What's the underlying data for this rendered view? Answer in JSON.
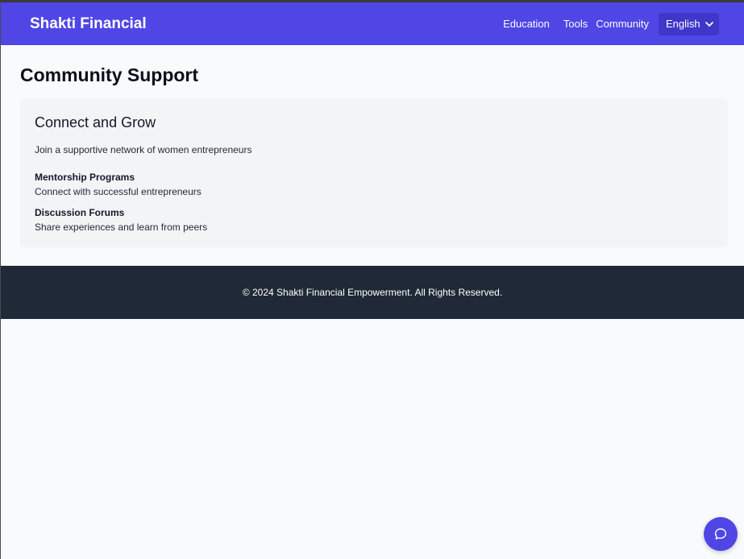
{
  "header": {
    "brand": "Shakti Financial",
    "nav": [
      {
        "label": "Education"
      },
      {
        "label": "Tools"
      },
      {
        "label": "Community"
      }
    ],
    "language": {
      "selected": "English",
      "icon": "chevron-down-icon"
    }
  },
  "main": {
    "title": "Community Support",
    "card": {
      "title": "Connect and Grow",
      "description": "Join a supportive network of women entrepreneurs",
      "features": [
        {
          "title": "Mentorship Programs",
          "description": "Connect with successful entrepreneurs"
        },
        {
          "title": "Discussion Forums",
          "description": "Share experiences and learn from peers"
        }
      ]
    }
  },
  "footer": {
    "text": "© 2024 Shakti Financial Empowerment. All Rights Reserved."
  },
  "chat": {
    "icon": "chat-bubble-icon"
  },
  "colors": {
    "primary": "#4f46e5",
    "footer_bg": "#1f2937",
    "page_bg": "#f9fafb",
    "card_bg": "#f3f4f6"
  }
}
